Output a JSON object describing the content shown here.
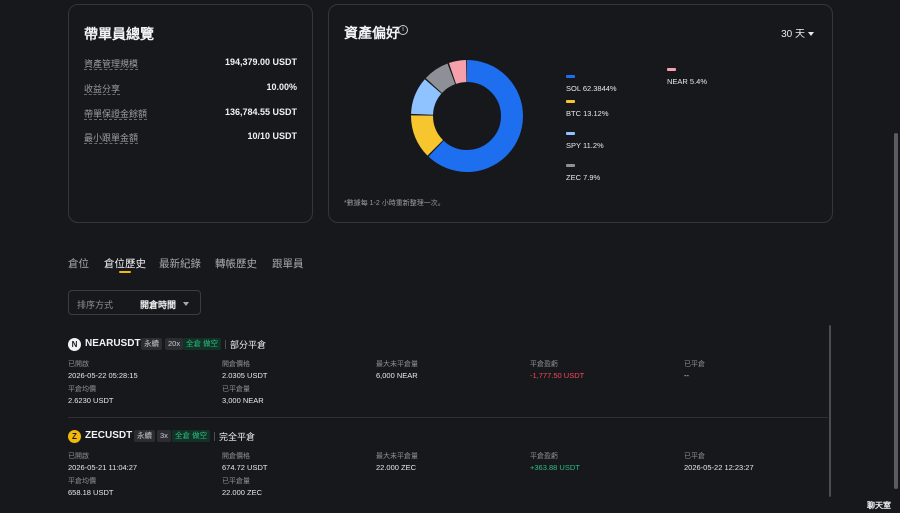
{
  "overview": {
    "title": "帶單員總覽",
    "rows": [
      {
        "label": "資產管理規模",
        "value": "194,379.00 USDT"
      },
      {
        "label": "收益分享",
        "value": "10.00%"
      },
      {
        "label": "帶單保證金餘額",
        "value": "136,784.55 USDT"
      },
      {
        "label": "最小跟單金額",
        "value": "10/10 USDT"
      }
    ]
  },
  "allocation": {
    "title": "資產偏好",
    "info_icon": "i",
    "period": "30 天",
    "note": "*數據每 1-2 小時重新整理一次。",
    "chart_data": {
      "type": "pie",
      "variant": "donut",
      "slices": [
        {
          "name": "SOL",
          "value": 62.3844,
          "label": "SOL 62.3844%",
          "color": "#1e6ff0"
        },
        {
          "name": "BTC",
          "value": 13.12,
          "label": "BTC 13.12%",
          "color": "#f7c52d"
        },
        {
          "name": "SPY",
          "value": 11.2,
          "label": "SPY 11.2%",
          "color": "#8ec3ff"
        },
        {
          "name": "ZEC",
          "value": 7.9,
          "label": "ZEC 7.9%",
          "color": "#8d9096"
        },
        {
          "name": "NEAR",
          "value": 5.4,
          "label": "NEAR 5.4%",
          "color": "#f5a0ab"
        }
      ]
    }
  },
  "tabs": [
    {
      "label": "倉位",
      "active": false
    },
    {
      "label": "倉位歷史",
      "active": true
    },
    {
      "label": "最新紀錄",
      "active": false
    },
    {
      "label": "轉帳歷史",
      "active": false
    },
    {
      "label": "跟單員",
      "active": false
    }
  ],
  "sort": {
    "label": "排序方式",
    "value": "開倉時間"
  },
  "positions": [
    {
      "coin_glyph": "N",
      "coin_bg": "#f2f2f4",
      "coin_fg": "#17181b",
      "symbol": "NEARUSDT",
      "tags": [
        "永續",
        "20x",
        "全倉 做空"
      ],
      "status": "部分平倉",
      "fields_row1": [
        {
          "label": "已開啟",
          "value": "2026-05-22 05:28:15",
          "tone": ""
        },
        {
          "label": "開倉價格",
          "value": "2.0305 USDT",
          "tone": ""
        },
        {
          "label": "最大未平倉量",
          "value": "6,000 NEAR",
          "tone": ""
        },
        {
          "label": "平倉盈虧",
          "value": "-1,777.50 USDT",
          "tone": "neg"
        },
        {
          "label": "已平倉",
          "value": "--",
          "tone": ""
        }
      ],
      "fields_row2": [
        {
          "label": "平倉均價",
          "value": "2.6230 USDT"
        },
        {
          "label": "已平倉量",
          "value": "3,000 NEAR"
        }
      ]
    },
    {
      "coin_glyph": "Z",
      "coin_bg": "#f0b90b",
      "coin_fg": "#17181b",
      "symbol": "ZECUSDT",
      "tags": [
        "永續",
        "3x",
        "全倉 做空"
      ],
      "status": "完全平倉",
      "fields_row1": [
        {
          "label": "已開啟",
          "value": "2026-05-21 11:04:27",
          "tone": ""
        },
        {
          "label": "開倉價格",
          "value": "674.72 USDT",
          "tone": ""
        },
        {
          "label": "最大未平倉量",
          "value": "22.000 ZEC",
          "tone": ""
        },
        {
          "label": "平倉盈虧",
          "value": "+363.88 USDT",
          "tone": "pos-green"
        },
        {
          "label": "已平倉",
          "value": "2026-05-22 12:23:27",
          "tone": ""
        }
      ],
      "fields_row2": [
        {
          "label": "平倉均價",
          "value": "658.18 USDT"
        },
        {
          "label": "已平倉量",
          "value": "22.000 ZEC"
        }
      ]
    }
  ],
  "chat_label": "聊天室"
}
